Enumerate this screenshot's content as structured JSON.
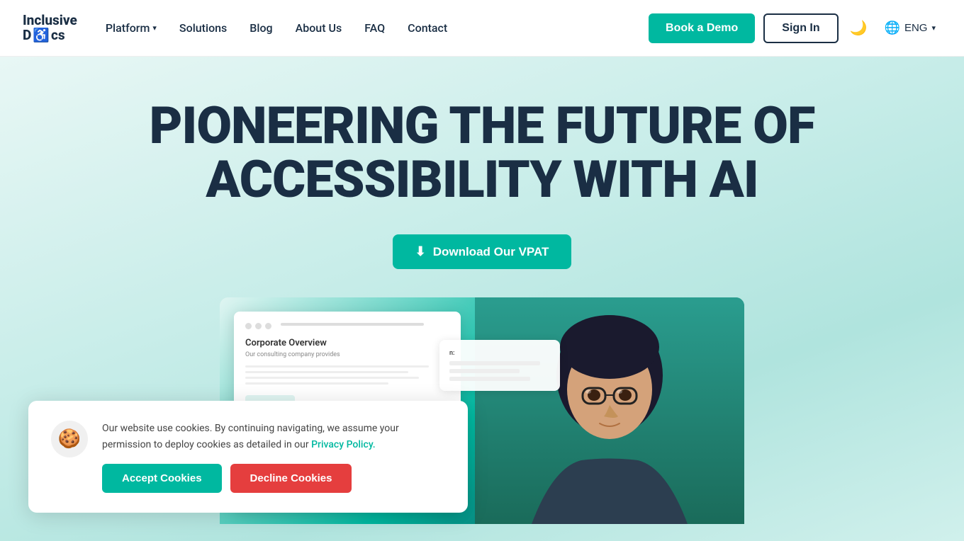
{
  "brand": {
    "name_line1": "Inclusive",
    "name_line2_pre": "D",
    "name_line2_icon": "♿",
    "name_line2_post": "cs"
  },
  "nav": {
    "platform_label": "Platform",
    "solutions_label": "Solutions",
    "blog_label": "Blog",
    "about_us_label": "About Us",
    "faq_label": "FAQ",
    "contact_label": "Contact"
  },
  "header_actions": {
    "book_demo_label": "Book a Demo",
    "sign_in_label": "Sign In",
    "lang_label": "ENG"
  },
  "hero": {
    "title_line1": "PIONEERING THE FUTURE OF",
    "title_line2": "ACCESSIBILITY WITH AI",
    "download_btn_label": "Download Our VPAT"
  },
  "doc_mockup": {
    "title": "Corporate Overview",
    "subtitle": "Our consulting company provides"
  },
  "cookie_banner": {
    "icon": "🍪",
    "message": "Our website use cookies. By continuing navigating, we assume your permission to deploy cookies as detailed in our ",
    "policy_link_text": "Privacy Policy.",
    "accept_label": "Accept Cookies",
    "decline_label": "Decline Cookies"
  }
}
